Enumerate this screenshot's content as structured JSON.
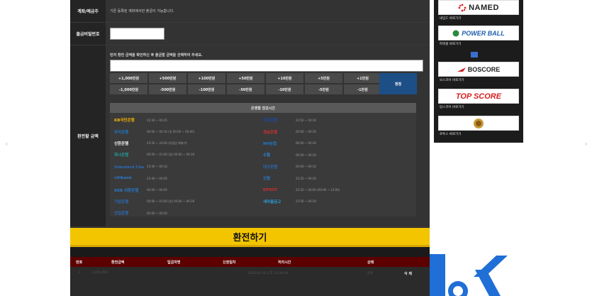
{
  "form": {
    "account_label": "계좌/예금주",
    "account_value": "기존 등록된 계좌에서만 출금이 가능합니다.",
    "password_label": "출금비밀번호",
    "password_value": "",
    "amount_label": "환전할 금액",
    "amount_hint": "먼저 환전 금액을 확인하신 후 출금할 금액을 선택하여 주세요.",
    "amount_value": "",
    "plus_buttons": [
      "+1,000만원",
      "+500만원",
      "+100만원",
      "+50만원",
      "+10만원",
      "+5만원",
      "+1만원"
    ],
    "minus_buttons": [
      "-1,000만원",
      "-500만원",
      "-100만원",
      "-50만원",
      "-10만원",
      "-5만원",
      "-1만원"
    ],
    "confirm_label": "정정"
  },
  "bank_hours": {
    "title": "은행별 점검시간",
    "banks": [
      {
        "name": "KB국민은행",
        "time": "23:30 ~ 00:35",
        "color": "#f5b400"
      },
      {
        "name": "광주은행",
        "time": "23:50 ~ 00:10",
        "color": "#1b4aa8"
      },
      {
        "name": "우리은행",
        "time": "00:00 ~ 00:10 (일 00:00 ~ 00:40)",
        "color": "#1f78c8"
      },
      {
        "name": "경남은행",
        "time": "00:00 ~ 00:30",
        "color": "#d03030"
      },
      {
        "name": "신한은행",
        "time": "23:50 ~ 24:00 (미점검 해제가)",
        "color": "#ffffff"
      },
      {
        "name": "NH농협",
        "time": "00:00 ~ 00:30",
        "color": "#1f78c8"
      },
      {
        "name": "하나은행",
        "time": "00:00 ~ 01:00 (일) 00:00 ~ 00:30",
        "color": "#21a39a"
      },
      {
        "name": "수협",
        "time": "00:00 ~ 00:30",
        "color": "#2a86d6"
      },
      {
        "name": "Standard Chartered SC제일은행",
        "time": "23:40 ~ 00:10",
        "color": "#2a6cb8"
      },
      {
        "name": "대구은행",
        "time": "00:00 ~ 00:10",
        "color": "#2a6cb8"
      },
      {
        "name": "citibank",
        "time": "23:40 ~ 00:05",
        "color": "#2a78c8"
      },
      {
        "name": "신협",
        "time": "23:50 ~ 00:30",
        "color": "#2a78c8"
      },
      {
        "name": "KEB 외환은행",
        "time": "00:00 ~ 00:05",
        "color": "#2a78c8"
      },
      {
        "name": "EPOST",
        "time": "23:50 ~ 00:00 (00:00 ~ 23:00)",
        "color": "#d03030"
      },
      {
        "name": "기업은행",
        "time": "00:00 ~ 01:00 (일) 00:00 ~ 00:30",
        "color": "#2a6cb8"
      },
      {
        "name": "새마을금고",
        "time": "23:50 ~ 00:30",
        "color": "#2a9ad6"
      },
      {
        "name": "산업은행",
        "time": "00:00 ~ 00:30",
        "color": "#2a6cb8"
      }
    ]
  },
  "submit_label": "환전하기",
  "history": {
    "columns": [
      "번호",
      "환전금액",
      "입금자명",
      "신청일자",
      "처리시간",
      "상태"
    ],
    "rows": [
      {
        "no": "1",
        "amount": "2,000,000",
        "depositor": "",
        "date": "",
        "time": "2024-06-18 오후 23:56:44",
        "status": "완료",
        "action": "삭 제"
      }
    ]
  },
  "sidebar": {
    "items": [
      {
        "logo": "NAMED",
        "caption": "네임드 바로가기"
      },
      {
        "logo": "POWER BALL",
        "caption": "파워볼 바로가기"
      },
      {
        "logo": "BOSCORE",
        "caption": "보스코어 바로가기"
      },
      {
        "logo": "TOP SCORE",
        "caption": "탑스코어 바로가기"
      },
      {
        "logo": "",
        "caption": "로투스 바로가기"
      }
    ]
  },
  "colors": {
    "accent": "#f2c500",
    "header_red": "#5c0000",
    "confirm_blue": "#1d4f86",
    "panel": "#2b2b2b"
  }
}
